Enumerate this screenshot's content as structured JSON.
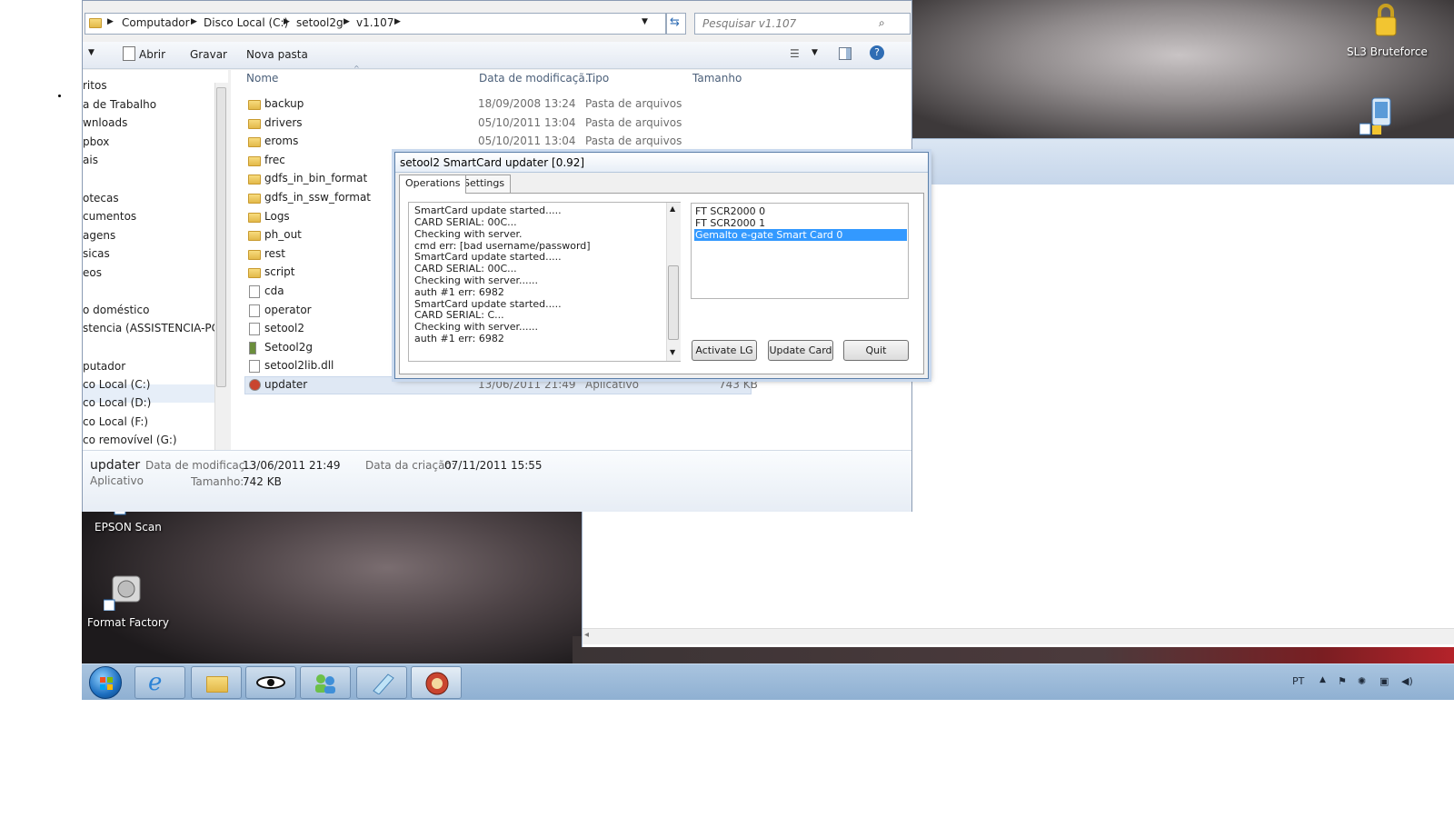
{
  "explorer": {
    "breadcrumb": [
      "Computador",
      "Disco Local (C:)",
      "setool2g",
      "v1.107"
    ],
    "search_placeholder": "Pesquisar v1.107",
    "toolbar": {
      "open": "Abrir",
      "burn": "Gravar",
      "new_folder": "Nova pasta"
    },
    "nav_items": [
      "ritos",
      "a de Trabalho",
      "wnloads",
      "pbox",
      "ais",
      "otecas",
      "cumentos",
      "agens",
      "sicas",
      "eos",
      "o doméstico",
      "stencia (ASSISTENCIA-PC)",
      "putador",
      "co Local (C:)",
      "co Local (D:)",
      "co Local (F:)",
      "co removível (G:)"
    ],
    "columns": {
      "name": "Nome",
      "date": "Data de modificaçã...",
      "type": "Tipo",
      "size": "Tamanho"
    },
    "files": [
      {
        "name": "backup",
        "date": "18/09/2008 13:24",
        "type": "Pasta de arquivos",
        "size": "",
        "icon": "folder-icon"
      },
      {
        "name": "drivers",
        "date": "05/10/2011 13:04",
        "type": "Pasta de arquivos",
        "size": "",
        "icon": "folder-icon"
      },
      {
        "name": "eroms",
        "date": "05/10/2011 13:04",
        "type": "Pasta de arquivos",
        "size": "",
        "icon": "folder-icon"
      },
      {
        "name": "frec",
        "date": "",
        "type": "",
        "size": "",
        "icon": "folder-icon"
      },
      {
        "name": "gdfs_in_bin_format",
        "date": "",
        "type": "",
        "size": "",
        "icon": "folder-icon"
      },
      {
        "name": "gdfs_in_ssw_format",
        "date": "",
        "type": "",
        "size": "",
        "icon": "folder-icon"
      },
      {
        "name": "Logs",
        "date": "",
        "type": "",
        "size": "",
        "icon": "folder-icon"
      },
      {
        "name": "ph_out",
        "date": "",
        "type": "",
        "size": "",
        "icon": "folder-icon"
      },
      {
        "name": "rest",
        "date": "",
        "type": "",
        "size": "",
        "icon": "folder-icon"
      },
      {
        "name": "script",
        "date": "",
        "type": "",
        "size": "",
        "icon": "folder-icon"
      },
      {
        "name": "cda",
        "date": "",
        "type": "",
        "size": "",
        "icon": "settings-file-icon"
      },
      {
        "name": "operator",
        "date": "",
        "type": "",
        "size": "",
        "icon": "settings-file-icon"
      },
      {
        "name": "setool2",
        "date": "",
        "type": "",
        "size": "",
        "icon": "settings-file-icon"
      },
      {
        "name": "Setool2g",
        "date": "",
        "type": "",
        "size": "",
        "icon": "application-icon"
      },
      {
        "name": "setool2lib.dll",
        "date": "",
        "type": "",
        "size": "",
        "icon": "dll-file-icon"
      },
      {
        "name": "updater",
        "date": "13/06/2011 21:49",
        "type": "Aplicativo",
        "size": "743 KB",
        "icon": "updater-app-icon"
      }
    ],
    "details": {
      "name": "updater",
      "kind": "Aplicativo",
      "modified_label": "Data de modificaç...",
      "modified_value": "13/06/2011 21:49",
      "created_label": "Data da criação:",
      "created_value": "07/11/2011 15:55",
      "size_label": "Tamanho:",
      "size_value": "742 KB"
    }
  },
  "dialog": {
    "title": "setool2 SmartCard updater [0.92]",
    "tabs": [
      "Operations",
      "Settings"
    ],
    "log_lines": [
      "SmartCard update started.....",
      "CARD SERIAL: 00C...",
      "Checking with server.",
      "cmd err: [bad username/password]",
      "SmartCard update started.....",
      "CARD SERIAL: 00C...",
      "Checking with server......",
      "auth #1 err: 6982",
      "SmartCard update started.....",
      "CARD SERIAL: C...",
      "Checking with server......",
      "auth #1 err: 6982"
    ],
    "cards": [
      "FT SCR2000 0",
      "FT SCR2000 1",
      "Gemalto e-gate Smart Card 0"
    ],
    "selected_card": "Gemalto e-gate Smart Card 0",
    "buttons": {
      "activate": "Activate LG",
      "update": "Update Card",
      "quit": "Quit"
    }
  },
  "desktop": {
    "icons": [
      "SL3 Bruteforce",
      "EPSON Scan",
      "Format Factory"
    ]
  },
  "taskbar": {
    "language": "PT",
    "pinned": [
      "start-orb-icon",
      "internet-explorer-icon",
      "explorer-folder-icon",
      "eye-app-icon",
      "users-app-icon",
      "notepad-app-icon",
      "updater-app-icon"
    ]
  }
}
